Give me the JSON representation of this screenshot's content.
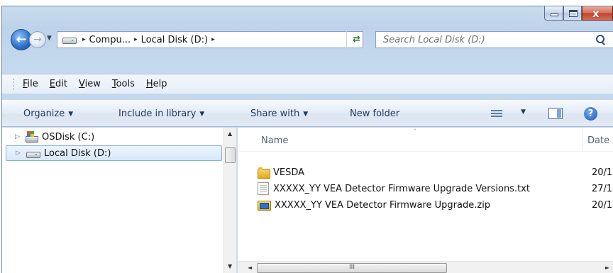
{
  "caption_buttons": {
    "minimize": "–",
    "maximize": "□",
    "close": "x"
  },
  "address": {
    "back_glyph": "←",
    "forward_glyph": "→",
    "crumb_sep": "▸",
    "crumbs": [
      "Compu...",
      "Local Disk (D:)"
    ],
    "dropdown_glyph": "▼",
    "refresh_glyph": "⇄"
  },
  "search": {
    "placeholder": "Search Local Disk (D:)"
  },
  "menu": [
    {
      "label": "File",
      "u": "F",
      "rest": "ile"
    },
    {
      "label": "Edit",
      "u": "E",
      "rest": "dit"
    },
    {
      "label": "View",
      "u": "V",
      "rest": "iew"
    },
    {
      "label": "Tools",
      "u": "T",
      "rest": "ools"
    },
    {
      "label": "Help",
      "u": "H",
      "rest": "elp"
    }
  ],
  "commands": {
    "organize": "Organize",
    "include": "Include in library",
    "share": "Share with",
    "new_folder": "New folder",
    "caret": "▼",
    "help": "?"
  },
  "tree": [
    {
      "label": "OSDisk (C:)",
      "icon": "windows-drive-icon",
      "selected": false
    },
    {
      "label": "Local Disk (D:)",
      "icon": "drive-icon",
      "selected": true
    }
  ],
  "tree_expander": "▷",
  "columns": {
    "name": "Name",
    "date": "Date",
    "sort_indicator": "˄"
  },
  "files": [
    {
      "name": "VESDA",
      "date": "20/1",
      "type": "folder"
    },
    {
      "name": "XXXXX_YY VEA Detector Firmware Upgrade Versions.txt",
      "date": "27/1",
      "type": "text"
    },
    {
      "name": "XXXXX_YY VEA Detector Firmware Upgrade.zip",
      "date": "20/1",
      "type": "zip"
    }
  ],
  "scroll": {
    "up": "▲",
    "down": "▼",
    "left": "◄",
    "right": "►",
    "grip": "III"
  },
  "colors": {
    "accent": "#2c6fc9",
    "selection": "#d8e8fa",
    "chrome": "#c4d8ee"
  }
}
